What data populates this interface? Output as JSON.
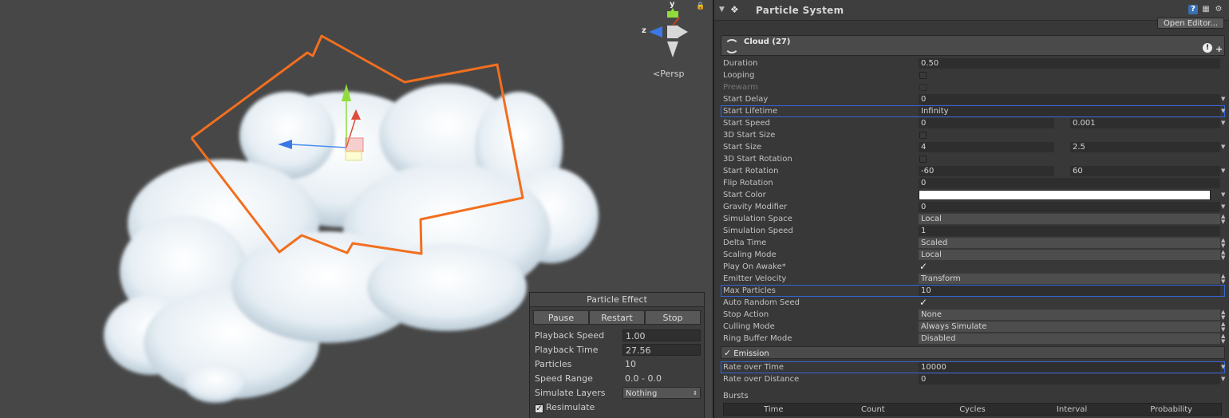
{
  "scene": {
    "persp_label": "Persp",
    "gizmo_axes": {
      "y": "y",
      "z": "z"
    },
    "icons": [
      "lock-icon",
      "scene-gizmo-icon",
      "move-handle-icon"
    ]
  },
  "particle_effect": {
    "title": "Particle Effect",
    "buttons": [
      "Pause",
      "Restart",
      "Stop"
    ],
    "rows": [
      {
        "label": "Playback Speed",
        "value": "1.00"
      },
      {
        "label": "Playback Time",
        "value": "27.56"
      },
      {
        "label": "Particles",
        "value": "10"
      },
      {
        "label": "Speed Range",
        "value": "0.0 - 0.0"
      },
      {
        "label": "Simulate Layers",
        "value": "Nothing"
      }
    ],
    "resimulate_label": "Resimulate",
    "resimulate_checked": true
  },
  "inspector": {
    "component_title": "Particle System",
    "open_editor": "Open Editor...",
    "system_name": "Cloud (27)",
    "colors": {
      "highlight": "#3565d8",
      "start_color": "#ffffff"
    },
    "properties": [
      {
        "label": "Duration",
        "value": "0.50"
      },
      {
        "label": "Looping",
        "checked": false
      },
      {
        "label": "Prewarm",
        "checked": false
      },
      {
        "label": "Start Delay",
        "value": "0"
      },
      {
        "label": "Start Lifetime",
        "value": "Infinity"
      },
      {
        "label": "Start Speed",
        "value": "0",
        "value2": "0.001"
      },
      {
        "label": "3D Start Size",
        "checked": false
      },
      {
        "label": "Start Size",
        "value": "4",
        "value2": "2.5"
      },
      {
        "label": "3D Start Rotation",
        "checked": false
      },
      {
        "label": "Start Rotation",
        "value": "-60",
        "value2": "60"
      },
      {
        "label": "Flip Rotation",
        "value": "0"
      },
      {
        "label": "Start Color"
      },
      {
        "label": "Gravity Modifier",
        "value": "0"
      },
      {
        "label": "Simulation Space",
        "value": "Local"
      },
      {
        "label": "Simulation Speed",
        "value": "1"
      },
      {
        "label": "Delta Time",
        "value": "Scaled"
      },
      {
        "label": "Scaling Mode",
        "value": "Local"
      },
      {
        "label": "Play On Awake*",
        "checked": true
      },
      {
        "label": "Emitter Velocity",
        "value": "Transform"
      },
      {
        "label": "Max Particles",
        "value": "10"
      },
      {
        "label": "Auto Random Seed",
        "checked": true
      },
      {
        "label": "Stop Action",
        "value": "None"
      },
      {
        "label": "Culling Mode",
        "value": "Always Simulate"
      },
      {
        "label": "Ring Buffer Mode",
        "value": "Disabled"
      }
    ],
    "emission": {
      "title": "Emission",
      "enabled": true,
      "rate_over_time_label": "Rate over Time",
      "rate_over_time": "10000",
      "rate_over_distance_label": "Rate over Distance",
      "rate_over_distance": "0",
      "bursts_label": "Bursts",
      "bursts_columns": [
        "Time",
        "Count",
        "Cycles",
        "Interval",
        "Probability"
      ]
    }
  }
}
